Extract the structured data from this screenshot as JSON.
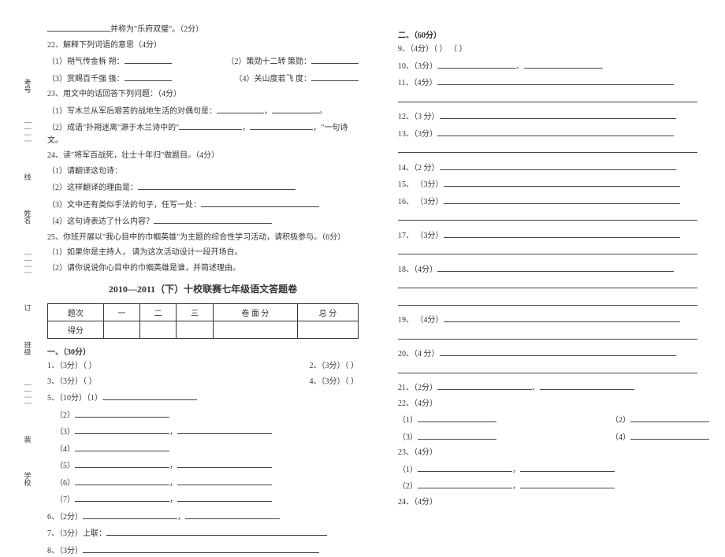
{
  "binding": {
    "labels": [
      "考号",
      "姓名",
      "班级",
      "学校"
    ],
    "marks": [
      "线",
      "订",
      "装"
    ],
    "divider": "┊┊┊┊"
  },
  "left": {
    "q21_tail": "并称为\"乐府双璧\"。（2分）",
    "q22": "22、解释下列词语的意思（4分）",
    "q22_1a": "（1）朔气传金柝    朔：",
    "q22_1b": "（2）策勋十二转    策勋：",
    "q22_2a": "（3）赏赐百千强    强：",
    "q22_2b": "（4）关山度若飞    度：",
    "q23": "23、用文中的话回答下列问题：（4分）",
    "q23_1": "（1）写木兰从军后艰苦的战地生活的对偶句是：",
    "q23_2": "（2）成语\"扑朔迷离\"源于木兰诗中的\"",
    "q23_2_tail": "\"一句诗文。",
    "q24": "24、读\"将军百战死，壮士十年归\"做题目。（4分）",
    "q24_1": "（1）请翻译这句诗：",
    "q24_2": "（2）这样翻译的理由是：",
    "q24_3": "（3）文中还有类似手法的句子，任写一处：",
    "q24_4": "（4）这句诗表达了什么内容？",
    "q25": "25、你班开展以\"我心目中的巾帼英雄\"为主题的综合性学习活动，请积极参与。（6分）",
    "q25_1": "（1）如果你是主持人，    请为这次活动设计一段开场白。",
    "q25_2": "（2）请你说说你心目中的巾帼英雄是谁，并简述理由。",
    "answer_title": "2010—2011（下）十校联赛七年级语文答题卷",
    "score_table": {
      "row1": [
        "题次",
        "一",
        "二",
        "三",
        "卷 面 分",
        "总  分"
      ],
      "row2": [
        "得分",
        "",
        "",
        "",
        "",
        ""
      ]
    },
    "sec1_head": "一、（30分）",
    "ans_q1": "1、（3分）（        ）",
    "ans_q2": "2、（3分）（        ）",
    "ans_q3": "3、（3分）（        ）",
    "ans_q4": "4、（3分）（        ）",
    "ans_q5": "5、（10分）（1）",
    "ans_q5_2": "（2）",
    "ans_q5_3": "（3）",
    "ans_q5_4": "（4）",
    "ans_q5_5": "（5）",
    "ans_q5_6": "（6）",
    "ans_q5_7": "（7）",
    "ans_q6": "6、（2分）",
    "ans_q7": "7、（3分）上联：",
    "ans_q8": "8、（3分）"
  },
  "right": {
    "sec2_head": "二、（60分）",
    "q9": "9、（4分）（        ）    （        ）",
    "q10": "10、（3分）",
    "q11": "11、（4分）",
    "q12": "12、（3 分）",
    "q13": "13、（3分）",
    "q14": "14、（2 分）",
    "q15": "15、  （3分）",
    "q16": "16、  （3分）",
    "q17": "17、 （3分）",
    "q18": "18、（4分）",
    "q19": "19、 （4分）",
    "q20": "20、（4 分）",
    "q21": "21、（2分）",
    "q22": "  22、（4分）",
    "q22_1": "   （1）",
    "q22_1b": "（2）",
    "q22_2": "   （3）",
    "q22_2b": "（4）",
    "q23": "23、（4分）",
    "q23_1": "（1）",
    "q23_2": "（2）",
    "q24": "24、（4分）"
  }
}
